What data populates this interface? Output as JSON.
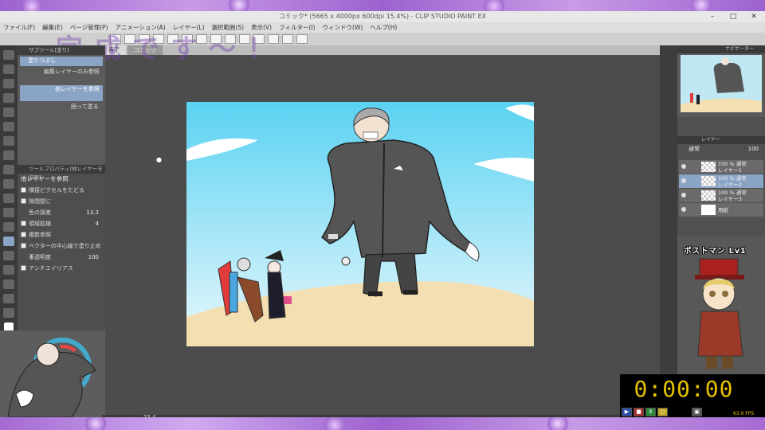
{
  "window": {
    "title": "コミック* (5665 x 4000px 600dpi 15.4%) - CLIP STUDIO PAINT EX"
  },
  "menu": [
    "ファイル(F)",
    "編集(E)",
    "ページ管理(P)",
    "アニメーション(A)",
    "レイヤー(L)",
    "選択範囲(S)",
    "表示(V)",
    "フィルター(I)",
    "ウィンドウ(W)",
    "ヘルプ(H)"
  ],
  "banner_text": "完成です〜！",
  "tabs": [
    "表了",
    "コミック"
  ],
  "subtool": {
    "header": "サブツール[塗り]",
    "items": [
      "塗りつぶし",
      "編集レイヤーのみ参照",
      "他レイヤーを参照",
      "囲って塗る"
    ]
  },
  "tool_property": {
    "header": "ツールプロパティ[他レイヤーを参照]",
    "name": "他レイヤーを参照",
    "rows": [
      {
        "label": "隣接ピクセルをたどる",
        "value": ""
      },
      {
        "label": "隙間閉じ",
        "value": ""
      },
      {
        "label": "色の誤差",
        "value": "13.3"
      },
      {
        "label": "領域拡縮",
        "value": "4"
      },
      {
        "label": "複数参照",
        "value": ""
      },
      {
        "label": "ベクターの中心線で塗り止める",
        "value": ""
      },
      {
        "label": "不透明度",
        "value": "100"
      },
      {
        "label": "アンチエイリアス",
        "value": ""
      }
    ]
  },
  "navigator": {
    "header": "ナビゲーター"
  },
  "layers": {
    "header": "レイヤー",
    "blend_mode": "通常",
    "opacity": "100",
    "items": [
      {
        "percent": "100 %",
        "mode": "通常",
        "name": "レイヤー1"
      },
      {
        "percent": "100 %",
        "mode": "通常",
        "name": "レイヤー2"
      },
      {
        "percent": "100 %",
        "mode": "通常",
        "name": "レイヤー3"
      },
      {
        "percent": "",
        "mode": "",
        "name": "用紙"
      }
    ]
  },
  "streamer_label": "ポストマン Lv1",
  "timer": {
    "value": "0:00:00",
    "fps": "63.9 FPS"
  },
  "zoom": "15.4",
  "colors": {
    "accent": "#8aa4c6",
    "timer": "#e6c200",
    "frame": "#b58ad2",
    "canvas_bg": "#4c4c4c"
  }
}
